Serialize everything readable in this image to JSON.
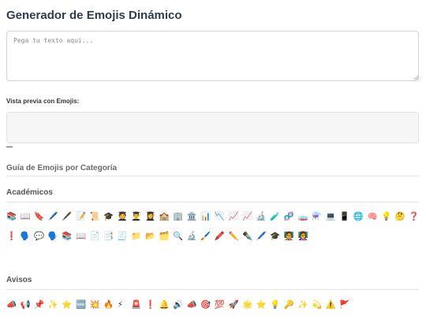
{
  "header": {
    "title": "Generador de Emojis Dinámico"
  },
  "input": {
    "placeholder": "Pega tu texto aquí..."
  },
  "preview": {
    "label": "Vista previa con Emojis:"
  },
  "guide": {
    "title": "Guía de Emojis por Categoría"
  },
  "categories": [
    {
      "name": "Académicos",
      "emojis": [
        "📚",
        "📖",
        "🔖",
        "🖊️",
        "🖋️",
        "📝",
        "📜",
        "🎓",
        "🧑‍🎓",
        "👨‍🎓",
        "👩‍🎓",
        "🏫",
        "🏢",
        "🏛️",
        "📊",
        "📉",
        "📈",
        "📈",
        "🔬",
        "🧪",
        "🧬",
        "🧫",
        "⚗️",
        "💻",
        "📱",
        "🌐",
        "🧠",
        "💡",
        "🤔",
        "❓",
        "❗",
        "🗣️",
        "💬",
        "🗣️",
        "📚",
        "📖",
        "📄",
        "📑",
        "🧾",
        "📁",
        "📂",
        "🗂️",
        "🔍",
        "🔬",
        "🖌️",
        "🖍️",
        "✏️",
        "✒️",
        "🖊️",
        "🎓",
        "🧑‍🏫",
        "👩‍🏫"
      ]
    },
    {
      "name": "Avisos",
      "emojis": [
        "📣",
        "📢",
        "📌",
        "✨",
        "⭐",
        "🆕",
        "💥",
        "🔥",
        "⚡",
        "🚨",
        "❗",
        "🔔",
        "🔊",
        "📣",
        "🎯",
        "💯",
        "🚀",
        "🌟",
        "⭐",
        "💡",
        "🔑",
        "✨",
        "💫",
        "⚠️",
        "🚩"
      ]
    }
  ]
}
